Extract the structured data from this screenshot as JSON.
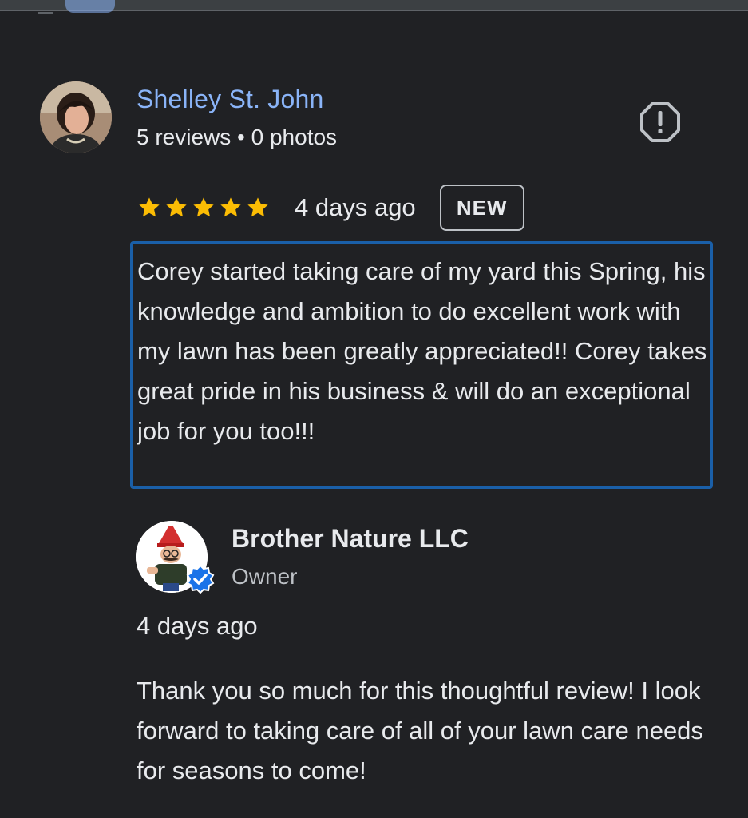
{
  "review": {
    "reviewer_name": "Shelley St. John",
    "reviewer_meta": "5 reviews • 0 photos",
    "rating": 5,
    "date": "4 days ago",
    "badge": "NEW",
    "text": "Corey started taking care of my yard this Spring, his knowledge and ambition to do excellent work with my lawn has been greatly appreciated!! Corey takes great pride in his business & will do an exceptional job for you too!!!"
  },
  "reply": {
    "owner_name": "Brother Nature LLC",
    "owner_role": "Owner",
    "date": "4 days ago",
    "text": "Thank you so much for this thoughtful review! I look forward to taking care of all of your lawn care needs for seasons to come!"
  },
  "icons": {
    "report": "report-flag-icon",
    "star": "star-icon",
    "verified": "verified-badge-icon"
  },
  "colors": {
    "background": "#202124",
    "link": "#8ab4f8",
    "star": "#fbbc04",
    "highlight_border": "#1a5fa8",
    "verified": "#1a73e8"
  }
}
